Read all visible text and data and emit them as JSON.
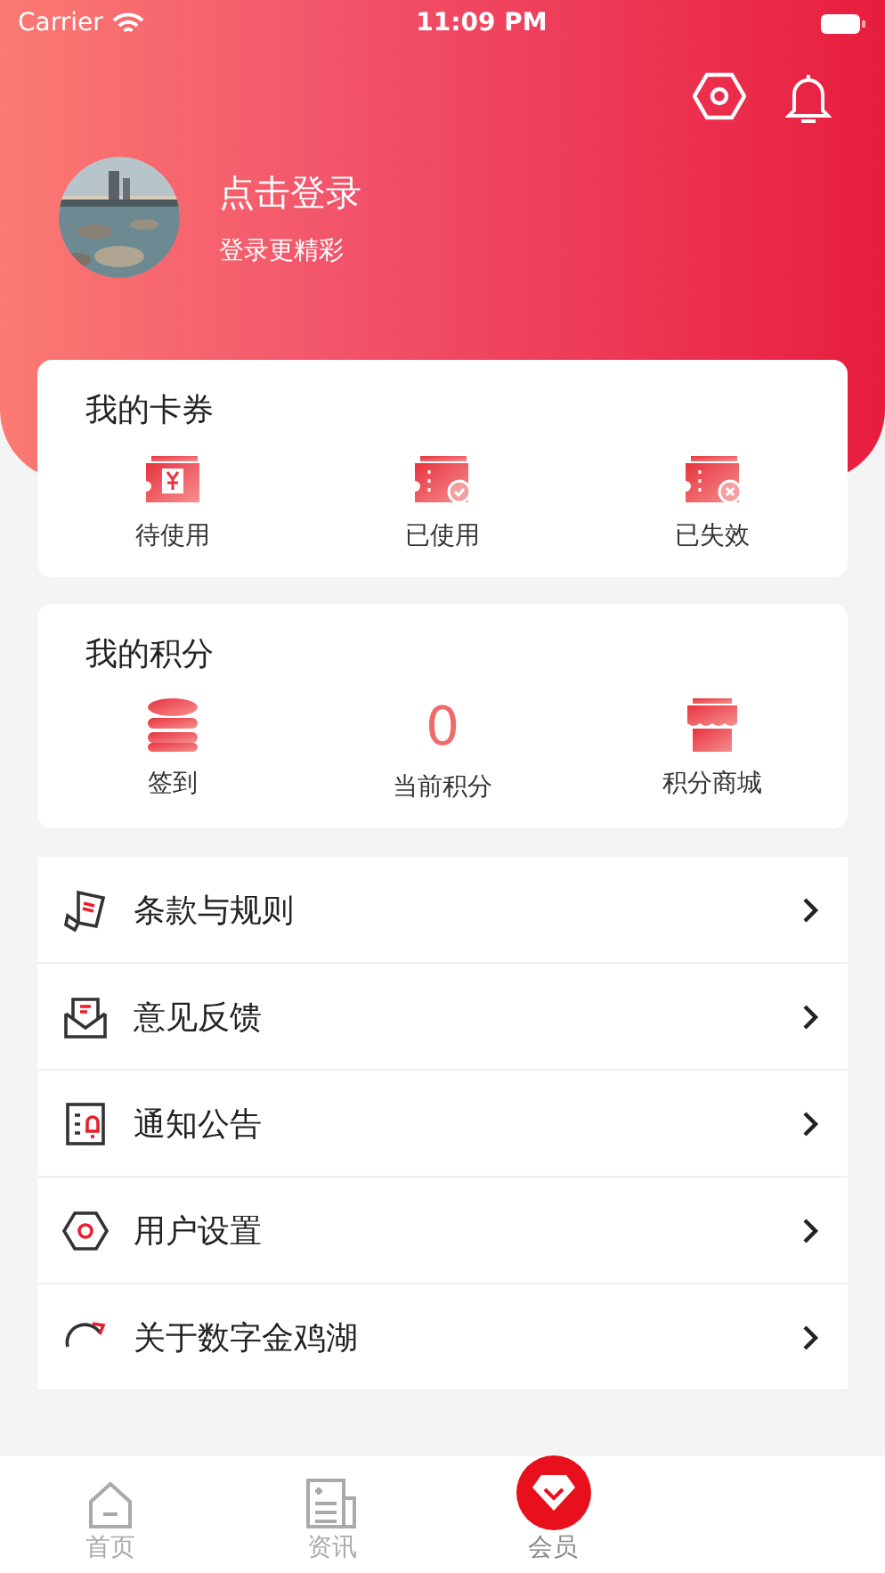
{
  "status_bar": {
    "carrier": "Carrier",
    "time": "11:09 PM"
  },
  "profile": {
    "title": "点击登录",
    "subtitle": "登录更精彩"
  },
  "coupons": {
    "title": "我的卡券",
    "items": [
      {
        "kind": "pending",
        "label": "待使用"
      },
      {
        "kind": "used",
        "label": "已使用"
      },
      {
        "kind": "expired",
        "label": "已失效"
      }
    ]
  },
  "points": {
    "title": "我的积分",
    "items": [
      {
        "kind": "checkin",
        "label": "签到"
      },
      {
        "kind": "value",
        "value": "0",
        "label": "当前积分"
      },
      {
        "kind": "mall",
        "label": "积分商城"
      }
    ]
  },
  "menu": [
    {
      "kind": "terms",
      "label": "条款与规则"
    },
    {
      "kind": "feedback",
      "label": "意见反馈"
    },
    {
      "kind": "notice",
      "label": "通知公告"
    },
    {
      "kind": "settings",
      "label": "用户设置"
    },
    {
      "kind": "about",
      "label": "关于数字金鸡湖"
    }
  ],
  "tab_bar": [
    {
      "kind": "home",
      "label": "首页",
      "selected": false
    },
    {
      "kind": "news",
      "label": "资讯",
      "selected": false
    },
    {
      "kind": "member",
      "label": "会员",
      "selected": true
    }
  ]
}
